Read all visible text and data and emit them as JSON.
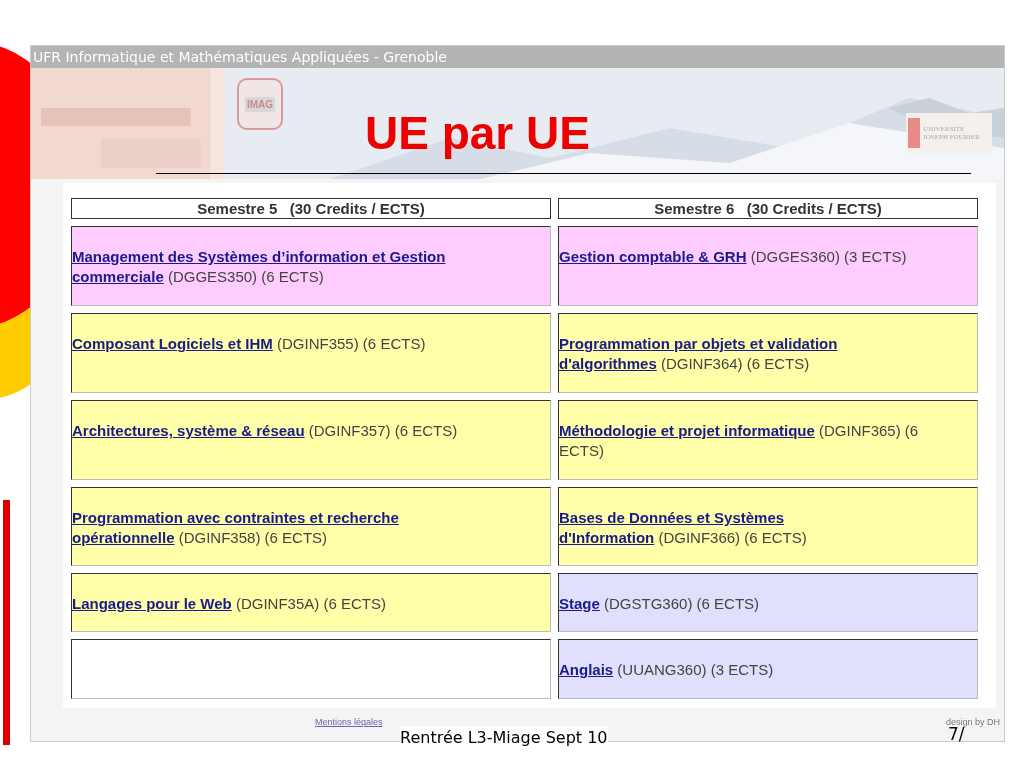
{
  "site": {
    "header": "UFR Informatique et Mathématiques Appliquées - Grenoble",
    "logo_left": "IMAG",
    "logo_right": "UNIVERSITE JOSEPH FOURIER"
  },
  "title": "UE par UE",
  "table": {
    "columns": [
      "Semestre 5   (30 Credits / ECTS)",
      "Semestre 6   (30 Credits / ECTS)"
    ],
    "rows": [
      [
        {
          "kind": "course",
          "title": " Management des Systèmes d’information et Gestion\ncommerciale",
          "details": " (DGGES350) (6 ECTS)",
          "color": "#ffccff"
        },
        {
          "kind": "course",
          "title": " Gestion comptable & GRH",
          "details": " (DGGES360) (3 ECTS)",
          "color": "#ffccff"
        }
      ],
      [
        {
          "kind": "course",
          "title": " Composant Logiciels et IHM",
          "details": " (DGINF355) (6 ECTS)",
          "color": "#ffffaa"
        },
        {
          "kind": "course",
          "title": " Programmation par objets et validation\nd'algorithmes",
          "details": " (DGINF364) (6 ECTS)",
          "color": "#ffffaa"
        }
      ],
      [
        {
          "kind": "course",
          "title": " Architectures, système & réseau",
          "details": " (DGINF357) (6 ECTS)",
          "color": "#ffffaa"
        },
        {
          "kind": "course",
          "title": " Méthodologie et projet informatique",
          "details": " (DGINF365) (6\nECTS)",
          "color": "#ffffaa"
        }
      ],
      [
        {
          "kind": "course",
          "title": " Programmation avec contraintes et recherche\nopérationnelle",
          "details": " (DGINF358) (6 ECTS)",
          "color": "#ffffaa"
        },
        {
          "kind": "course",
          "title": " Bases de Données et Systèmes\nd'Information",
          "details": " (DGINF366) (6 ECTS)",
          "color": "#ffffaa"
        }
      ],
      [
        {
          "kind": "course",
          "title": " Langages pour le Web",
          "details": " (DGINF35A) (6 ECTS)",
          "color": "#ffffaa"
        },
        {
          "kind": "course",
          "title": " Stage",
          "details": " (DGSTG360) (6 ECTS)",
          "color": "#e0e0fc"
        }
      ],
      [
        {
          "kind": "empty"
        },
        {
          "kind": "course",
          "title": " Anglais",
          "details": " (UUANG360) (3 ECTS)",
          "color": "#e0e0fc"
        }
      ]
    ]
  },
  "site_footer": {
    "link": "Mentions légales",
    "credit": "design by DH"
  },
  "slide_footer": {
    "text": "Rentrée L3-Miage Sept 10",
    "page": "7/"
  }
}
